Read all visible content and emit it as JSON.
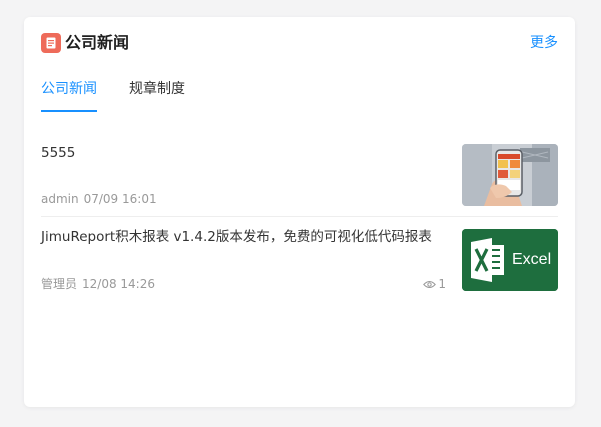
{
  "header": {
    "title": "公司新闻",
    "more_label": "更多",
    "icon": "news-icon",
    "icon_color": "#ee6b5a"
  },
  "tabs": [
    {
      "label": "公司新闻",
      "active": true
    },
    {
      "label": "规章制度",
      "active": false
    }
  ],
  "accent_color": "#1890ff",
  "news": [
    {
      "title": "5555",
      "author": "admin",
      "time": "07/09 16:01",
      "thumbnail": "phone-shopping-photo"
    },
    {
      "title": "JimuReport积木报表 v1.4.2版本发布，免费的可视化低代码报表",
      "author": "管理员",
      "time": "12/08 14:26",
      "views": "1",
      "thumbnail": "excel-logo",
      "thumbnail_label": "Excel"
    }
  ]
}
